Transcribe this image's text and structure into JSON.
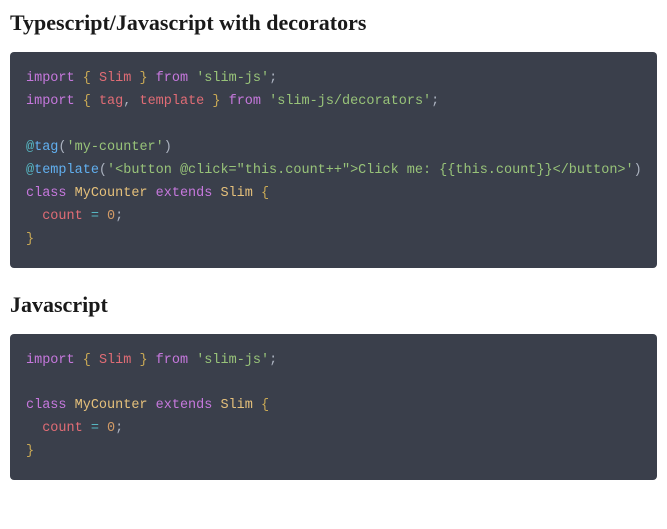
{
  "sections": [
    {
      "heading": "Typescript/Javascript with decorators",
      "code_tokens": [
        {
          "t": "import",
          "c": "tok-kw"
        },
        {
          "t": " "
        },
        {
          "t": "{",
          "c": "tok-brace"
        },
        {
          "t": " "
        },
        {
          "t": "Slim",
          "c": "tok-ident"
        },
        {
          "t": " "
        },
        {
          "t": "}",
          "c": "tok-brace"
        },
        {
          "t": " "
        },
        {
          "t": "from",
          "c": "tok-kw"
        },
        {
          "t": " "
        },
        {
          "t": "'slim-js'",
          "c": "tok-str"
        },
        {
          "t": ";",
          "c": "tok-punc"
        },
        {
          "t": "\n"
        },
        {
          "t": "import",
          "c": "tok-kw"
        },
        {
          "t": " "
        },
        {
          "t": "{",
          "c": "tok-brace"
        },
        {
          "t": " "
        },
        {
          "t": "tag",
          "c": "tok-ident"
        },
        {
          "t": ","
        },
        {
          "t": " "
        },
        {
          "t": "template",
          "c": "tok-ident"
        },
        {
          "t": " "
        },
        {
          "t": "}",
          "c": "tok-brace"
        },
        {
          "t": " "
        },
        {
          "t": "from",
          "c": "tok-kw"
        },
        {
          "t": " "
        },
        {
          "t": "'slim-js/decorators'",
          "c": "tok-str"
        },
        {
          "t": ";",
          "c": "tok-punc"
        },
        {
          "t": "\n"
        },
        {
          "t": "\n"
        },
        {
          "t": "@",
          "c": "tok-op"
        },
        {
          "t": "tag",
          "c": "tok-dec"
        },
        {
          "t": "(",
          "c": "tok-punc"
        },
        {
          "t": "'my-counter'",
          "c": "tok-str"
        },
        {
          "t": ")",
          "c": "tok-punc"
        },
        {
          "t": "\n"
        },
        {
          "t": "@",
          "c": "tok-op"
        },
        {
          "t": "template",
          "c": "tok-dec"
        },
        {
          "t": "(",
          "c": "tok-punc"
        },
        {
          "t": "'<button @click=\"this.count++\">Click me: {{this.count}}</button>'",
          "c": "tok-str"
        },
        {
          "t": ")",
          "c": "tok-punc"
        },
        {
          "t": "\n"
        },
        {
          "t": "class",
          "c": "tok-kw"
        },
        {
          "t": " "
        },
        {
          "t": "MyCounter",
          "c": "tok-class"
        },
        {
          "t": " "
        },
        {
          "t": "extends",
          "c": "tok-kw"
        },
        {
          "t": " "
        },
        {
          "t": "Slim",
          "c": "tok-class"
        },
        {
          "t": " "
        },
        {
          "t": "{",
          "c": "tok-brace"
        },
        {
          "t": "\n"
        },
        {
          "t": "  "
        },
        {
          "t": "count",
          "c": "tok-prop"
        },
        {
          "t": " "
        },
        {
          "t": "=",
          "c": "tok-op"
        },
        {
          "t": " "
        },
        {
          "t": "0",
          "c": "tok-num"
        },
        {
          "t": ";",
          "c": "tok-punc"
        },
        {
          "t": "\n"
        },
        {
          "t": "}",
          "c": "tok-brace"
        }
      ]
    },
    {
      "heading": "Javascript",
      "code_tokens": [
        {
          "t": "import",
          "c": "tok-kw"
        },
        {
          "t": " "
        },
        {
          "t": "{",
          "c": "tok-brace"
        },
        {
          "t": " "
        },
        {
          "t": "Slim",
          "c": "tok-ident"
        },
        {
          "t": " "
        },
        {
          "t": "}",
          "c": "tok-brace"
        },
        {
          "t": " "
        },
        {
          "t": "from",
          "c": "tok-kw"
        },
        {
          "t": " "
        },
        {
          "t": "'slim-js'",
          "c": "tok-str"
        },
        {
          "t": ";",
          "c": "tok-punc"
        },
        {
          "t": "\n"
        },
        {
          "t": "\n"
        },
        {
          "t": "class",
          "c": "tok-kw"
        },
        {
          "t": " "
        },
        {
          "t": "MyCounter",
          "c": "tok-class"
        },
        {
          "t": " "
        },
        {
          "t": "extends",
          "c": "tok-kw"
        },
        {
          "t": " "
        },
        {
          "t": "Slim",
          "c": "tok-class"
        },
        {
          "t": " "
        },
        {
          "t": "{",
          "c": "tok-brace"
        },
        {
          "t": "\n"
        },
        {
          "t": "  "
        },
        {
          "t": "count",
          "c": "tok-prop"
        },
        {
          "t": " "
        },
        {
          "t": "=",
          "c": "tok-op"
        },
        {
          "t": " "
        },
        {
          "t": "0",
          "c": "tok-num"
        },
        {
          "t": ";",
          "c": "tok-punc"
        },
        {
          "t": "\n"
        },
        {
          "t": "}",
          "c": "tok-brace"
        }
      ]
    }
  ]
}
